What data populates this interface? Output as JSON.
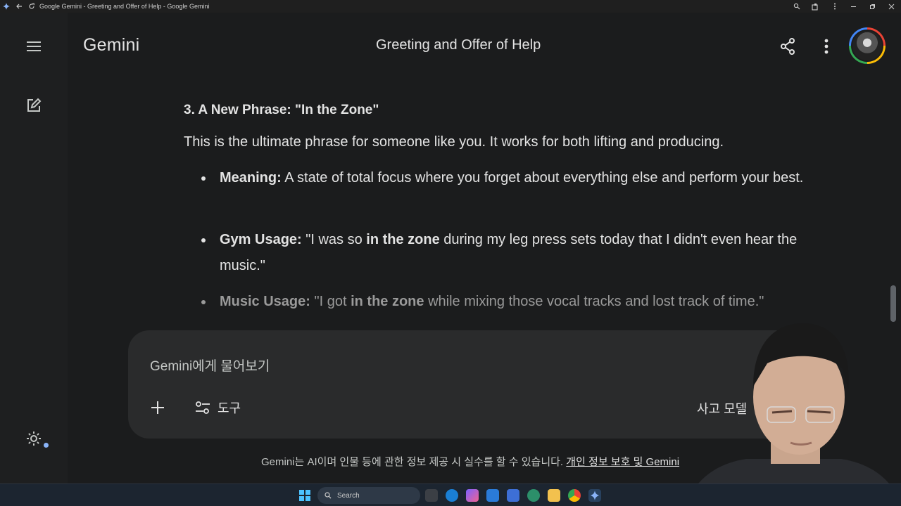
{
  "window": {
    "title": "Google Gemini - Greeting and Offer of Help - Google Gemini"
  },
  "header": {
    "brand": "Gemini",
    "conversation_title": "Greeting and Offer of Help"
  },
  "content": {
    "heading": "3. A New Phrase: \"In the Zone\"",
    "intro": "This is the ultimate phrase for someone like you. It works for both lifting and producing.",
    "bullets": [
      {
        "label": "Meaning:",
        "text": " A state of total focus where you forget about everything else and perform your best."
      },
      {
        "label": "Gym Usage:",
        "pre": " \"I was so ",
        "emph": "in the zone",
        "post": " during my leg press sets today that I didn't even hear the music.\""
      },
      {
        "label": "Music Usage:",
        "pre": " \"I got ",
        "emph": "in the zone",
        "post": " while mixing those vocal tracks and lost track of time.\""
      }
    ]
  },
  "input": {
    "placeholder": "Gemini에게 물어보기",
    "tools_label": "도구",
    "model_label": "사고 모델"
  },
  "footer": {
    "disclaimer": "Gemini는 AI이며 인물 등에 관한 정보 제공 시 실수를 할 수 있습니다. ",
    "link": "개인 정보 보호 및 Gemini"
  },
  "taskbar": {
    "search_label": "Search"
  },
  "colors": {
    "background": "#1b1c1d",
    "sidebar": "#1e1f20",
    "input_box": "#2a2b2c",
    "text": "#e3e3e3",
    "taskbar": "#1c2530"
  }
}
